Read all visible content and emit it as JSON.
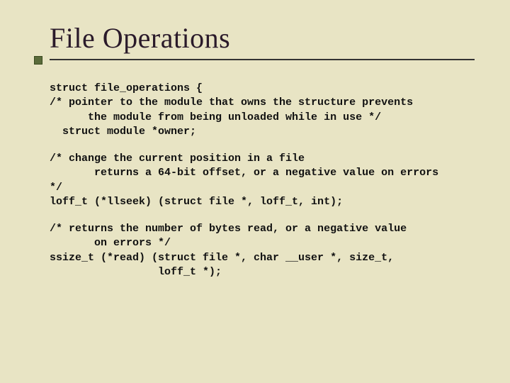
{
  "title": "File Operations",
  "code": {
    "block1": "struct file_operations {\n/* pointer to the module that owns the structure prevents\n      the module from being unloaded while in use */\n  struct module *owner;",
    "block2": "/* change the current position in a file\n       returns a 64-bit offset, or a negative value on errors\n*/\nloff_t (*llseek) (struct file *, loff_t, int);",
    "block3": "/* returns the number of bytes read, or a negative value\n       on errors */\nssize_t (*read) (struct file *, char __user *, size_t,\n                 loff_t *);"
  }
}
